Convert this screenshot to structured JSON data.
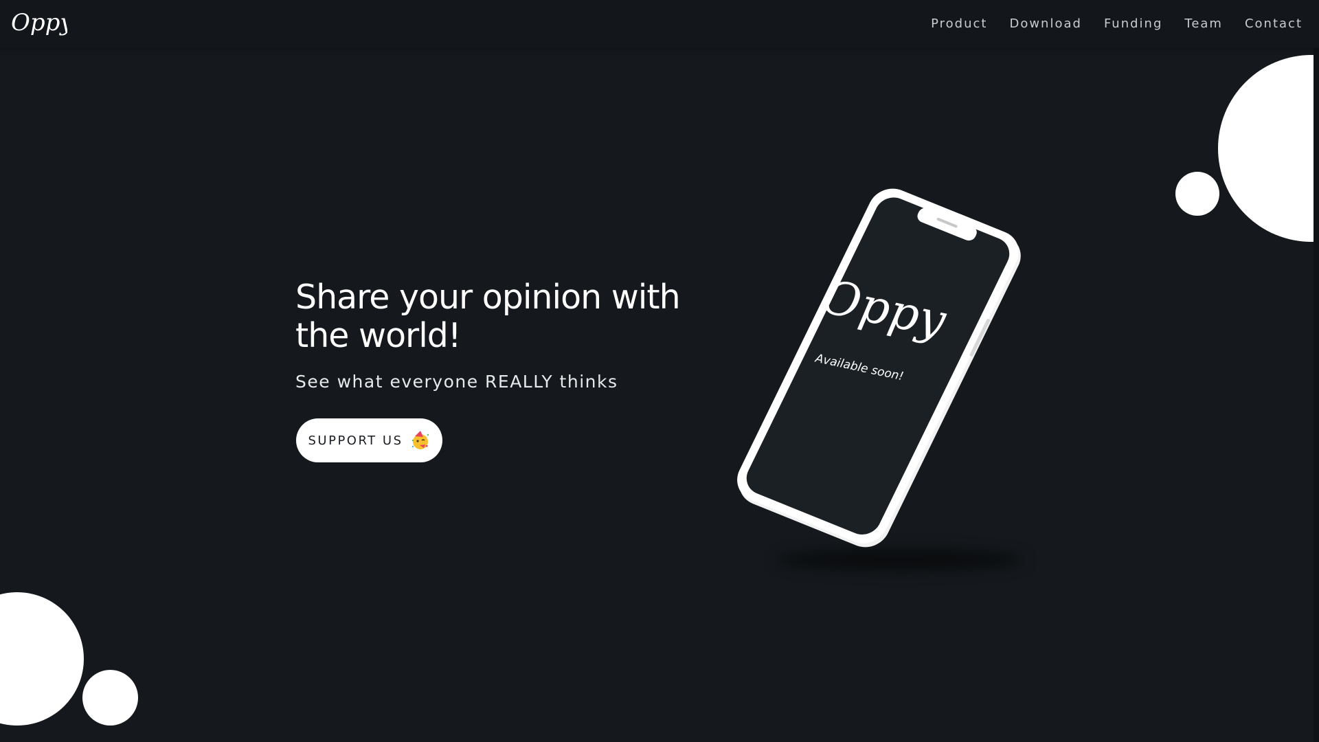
{
  "nav": {
    "logo_text": "Oppy",
    "links": [
      {
        "label": "Product"
      },
      {
        "label": "Download"
      },
      {
        "label": "Funding"
      },
      {
        "label": "Team"
      },
      {
        "label": "Contact"
      }
    ]
  },
  "hero": {
    "title": "Share your opinion with the world!",
    "subtitle": "See what everyone REALLY thinks",
    "cta_label": "SUPPORT US",
    "cta_emoji": "party-face-icon"
  },
  "phone": {
    "screen_logo": "Oppy",
    "screen_caption": "Available soon!"
  },
  "colors": {
    "background": "#15191d",
    "navbar": "#13171b",
    "text": "#ffffff",
    "nav_text": "#c9ccd0",
    "accent": "#ffffff"
  }
}
